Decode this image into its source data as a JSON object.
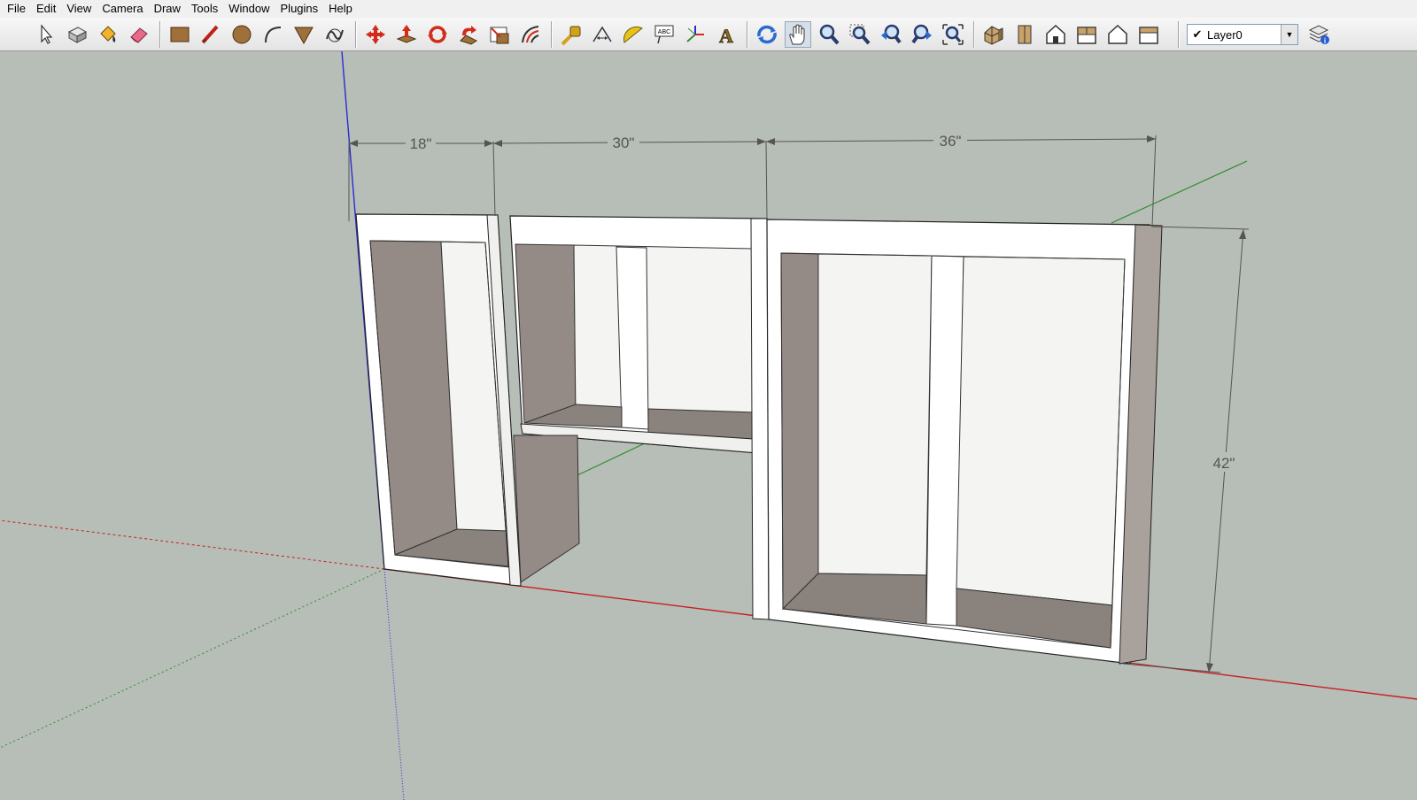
{
  "menu": [
    "File",
    "Edit",
    "View",
    "Camera",
    "Draw",
    "Tools",
    "Window",
    "Plugins",
    "Help"
  ],
  "toolbar": {
    "tools": [
      {
        "name": "select-tool-icon"
      },
      {
        "name": "make-component-tool-icon"
      },
      {
        "name": "paint-bucket-tool-icon"
      },
      {
        "name": "eraser-tool-icon"
      },
      {
        "name": "rectangle-tool-icon"
      },
      {
        "name": "line-tool-icon"
      },
      {
        "name": "circle-tool-icon"
      },
      {
        "name": "arc-tool-icon"
      },
      {
        "name": "polygon-tool-icon"
      },
      {
        "name": "freehand-tool-icon"
      },
      {
        "name": "move-tool-icon"
      },
      {
        "name": "push-pull-tool-icon"
      },
      {
        "name": "rotate-tool-icon"
      },
      {
        "name": "follow-me-tool-icon"
      },
      {
        "name": "scale-tool-icon"
      },
      {
        "name": "offset-tool-icon"
      },
      {
        "name": "tape-measure-tool-icon"
      },
      {
        "name": "dimension-tool-icon"
      },
      {
        "name": "protractor-tool-icon"
      },
      {
        "name": "text-tool-icon",
        "text": "ABC"
      },
      {
        "name": "axes-tool-icon"
      },
      {
        "name": "3d-text-tool-icon",
        "text": "A"
      },
      {
        "name": "orbit-tool-icon"
      },
      {
        "name": "pan-tool-icon"
      },
      {
        "name": "zoom-tool-icon"
      },
      {
        "name": "zoom-window-tool-icon"
      },
      {
        "name": "previous-view-icon"
      },
      {
        "name": "next-view-icon"
      },
      {
        "name": "zoom-extents-icon"
      },
      {
        "name": "iso-view-icon"
      },
      {
        "name": "top-view-icon"
      },
      {
        "name": "front-view-icon"
      },
      {
        "name": "right-view-icon"
      },
      {
        "name": "back-view-icon"
      },
      {
        "name": "left-view-icon"
      }
    ],
    "active_tool": "pan-tool-icon"
  },
  "layer": {
    "checked": "✔",
    "name": "Layer0"
  },
  "dimensions": {
    "width_1": "18\"",
    "width_2": "30\"",
    "width_3": "36\"",
    "height": "42\""
  },
  "colors": {
    "background": "#b7bdb7",
    "axis_red": "#c62020",
    "axis_green": "#2f8f2f",
    "axis_blue": "#2b2bd0"
  }
}
